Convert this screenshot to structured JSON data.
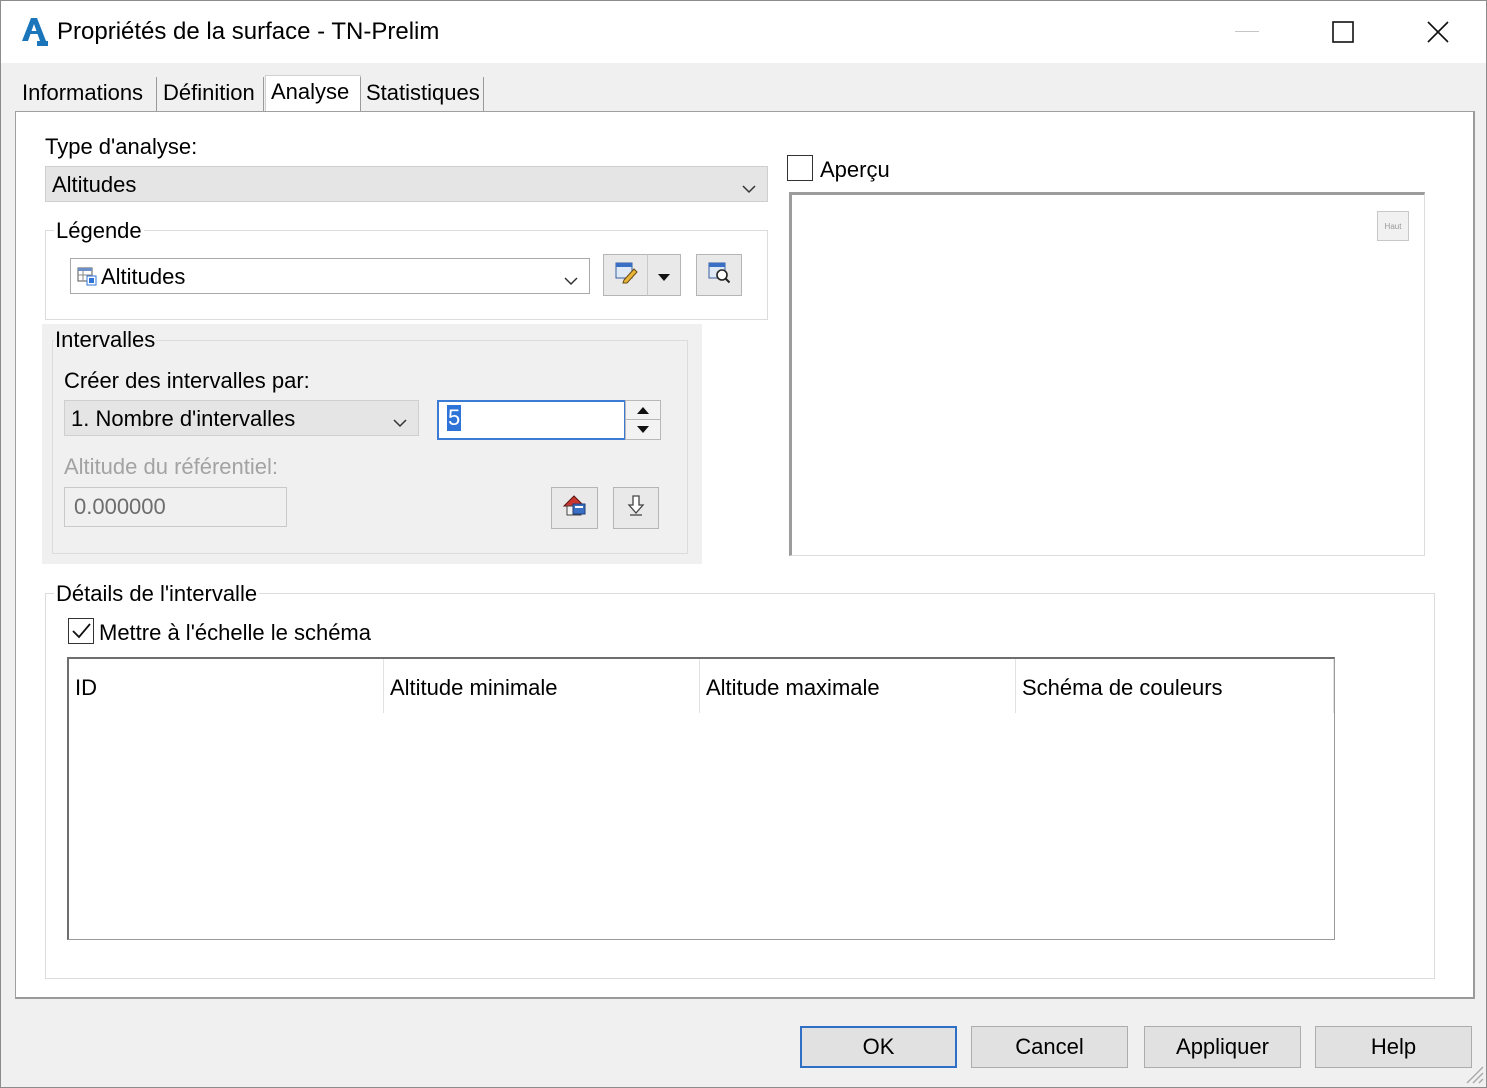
{
  "window": {
    "title": "Propriétés de la surface - TN-Prelim",
    "app_icon": "autocad-icon",
    "controls": [
      "minimize-icon",
      "maximize-icon",
      "close-icon"
    ]
  },
  "tabs": [
    {
      "label": "Informations",
      "active": false
    },
    {
      "label": "Définition",
      "active": false
    },
    {
      "label": "Analyse",
      "active": true
    },
    {
      "label": "Statistiques",
      "active": false
    }
  ],
  "analysis": {
    "type_label": "Type d'analyse:",
    "type_value": "Altitudes"
  },
  "legend": {
    "group_label": "Légende",
    "value": "Altitudes",
    "edit_icon": "edit-style-icon",
    "dropdown_icon": "dropdown-arrow-icon",
    "preview_icon": "preview-style-icon"
  },
  "intervals": {
    "group_label": "Intervalles",
    "create_label": "Créer des intervalles par:",
    "method_value": "1. Nombre d'intervalles",
    "count_value": "5",
    "reference_label": "Altitude du référentiel:",
    "reference_value": "0.000000",
    "run_icon": "run-analysis-icon",
    "down_icon": "arrow-down-icon"
  },
  "preview": {
    "checkbox_label": "Aperçu",
    "checked": false,
    "corner_label": "Haut"
  },
  "details": {
    "group_label": "Détails de l'intervalle",
    "scale_label": "Mettre à l'échelle le schéma",
    "scale_checked": true,
    "columns": [
      "ID",
      "Altitude minimale",
      "Altitude maximale",
      "Schéma de couleurs"
    ]
  },
  "buttons": {
    "ok": "OK",
    "cancel": "Cancel",
    "apply": "Appliquer",
    "help": "Help"
  }
}
